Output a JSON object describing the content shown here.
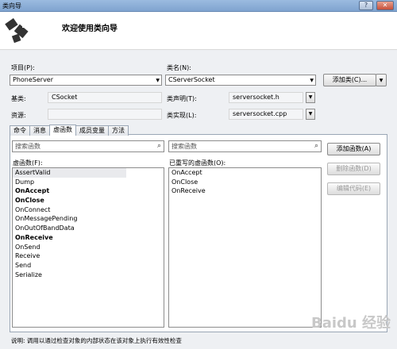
{
  "window": {
    "title": "类向导",
    "controls": [
      "?",
      "✕"
    ]
  },
  "header": {
    "title": "欢迎使用类向导"
  },
  "project": {
    "label": "项目(P):",
    "value": "PhoneServer"
  },
  "class_name": {
    "label": "类名(N):",
    "value": "CServerSocket"
  },
  "add_class_button": "添加类(C)...",
  "base_class": {
    "label": "基类:",
    "value": "CSocket"
  },
  "class_declaration": {
    "label": "类声明(T):",
    "value": "serversocket.h"
  },
  "resource": {
    "label": "资源:",
    "value": ""
  },
  "class_implementation": {
    "label": "类实现(L):",
    "value": "serversocket.cpp"
  },
  "tabs": [
    "命令",
    "消息",
    "虚函数",
    "成员变量",
    "方法"
  ],
  "active_tab": "虚函数",
  "search_left": {
    "placeholder": "搜索函数"
  },
  "search_right": {
    "placeholder": "搜索函数"
  },
  "virtual_functions": {
    "label": "虚函数(F):",
    "items": [
      "AssertValid",
      "Dump",
      "OnAccept",
      "OnClose",
      "OnConnect",
      "OnMessagePending",
      "OnOutOfBandData",
      "OnReceive",
      "OnSend",
      "Receive",
      "Send",
      "Serialize"
    ]
  },
  "overridden_functions": {
    "label": "已重写的虚函数(O):",
    "items": [
      "OnAccept",
      "OnClose",
      "OnReceive"
    ]
  },
  "buttons": {
    "add_function": "添加函数(A)",
    "delete_function": "删除函数(D)",
    "edit_code": "编辑代码(E)"
  },
  "status": "说明:   调用以通过检查对象的内部状态在该对象上执行有效性检查",
  "watermark": "Baidu 经验",
  "icons": {
    "help": "?",
    "close": "✕",
    "dropdown": "▼",
    "search": "⌕"
  }
}
